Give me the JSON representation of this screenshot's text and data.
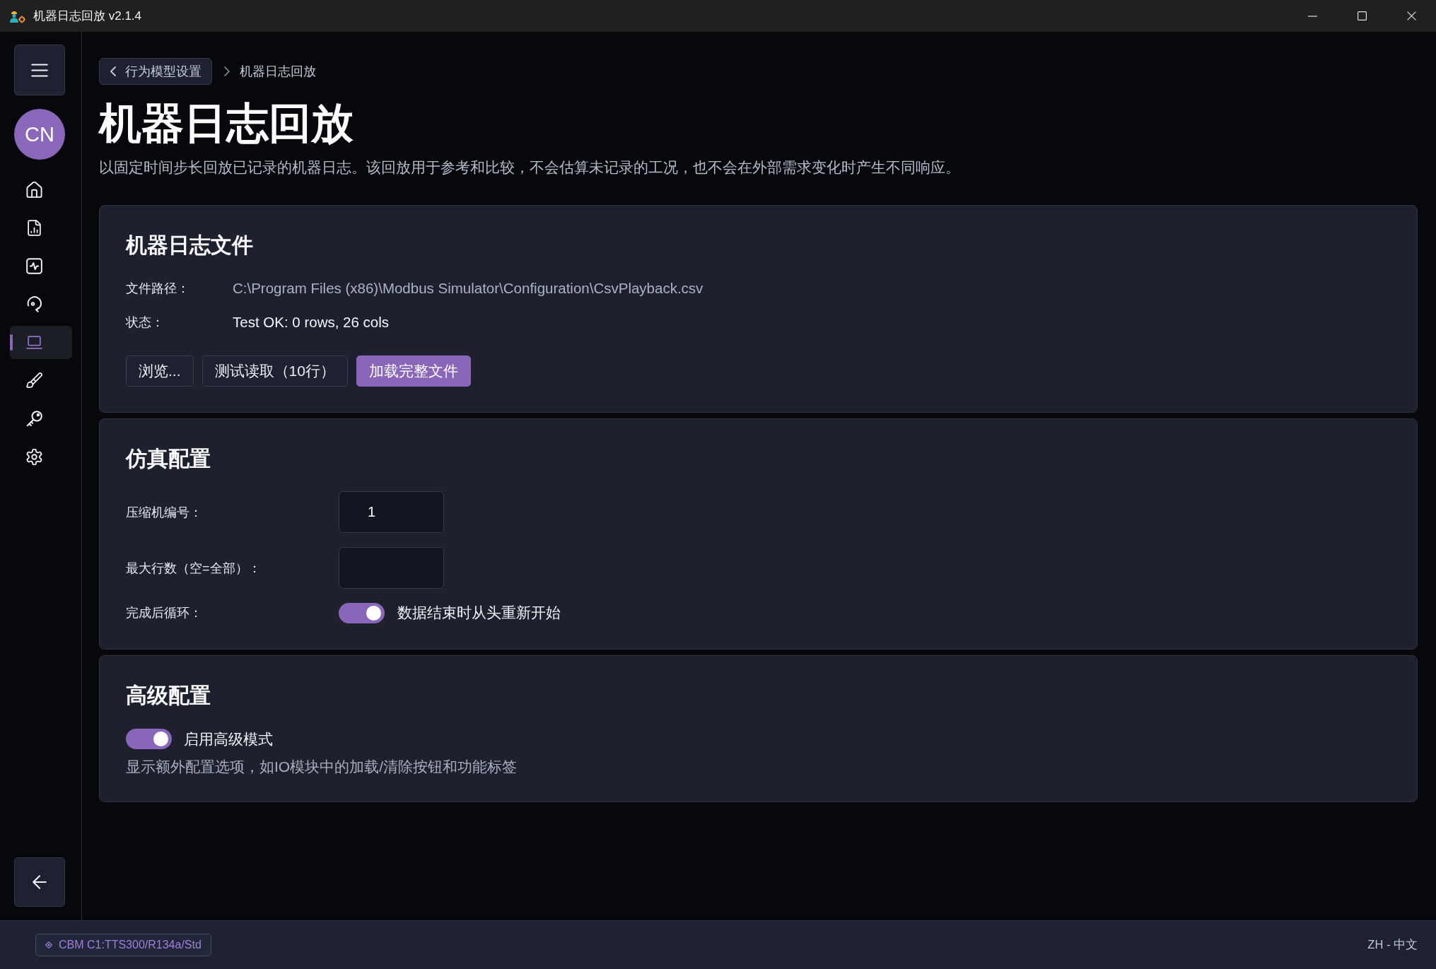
{
  "window": {
    "title": "机器日志回放 v2.1.4"
  },
  "sidebar": {
    "avatar": "CN",
    "items": [
      {
        "kind": "home",
        "selected": false
      },
      {
        "kind": "report",
        "selected": false
      },
      {
        "kind": "activity",
        "selected": false
      },
      {
        "kind": "replay",
        "selected": false
      },
      {
        "kind": "laptop",
        "selected": true
      },
      {
        "kind": "brush",
        "selected": false
      },
      {
        "kind": "key",
        "selected": false
      },
      {
        "kind": "settings",
        "selected": false
      }
    ]
  },
  "breadcrumb": {
    "parent": "行为模型设置",
    "current": "机器日志回放"
  },
  "page": {
    "title": "机器日志回放",
    "description": "以固定时间步长回放已记录的机器日志。该回放用于参考和比较，不会估算未记录的工况，也不会在外部需求变化时产生不同响应。"
  },
  "log_file": {
    "title": "机器日志文件",
    "fields": [
      {
        "kind": "path",
        "label": "文件路径：",
        "value": "C:\\Program Files (x86)\\Modbus Simulator\\Configuration\\CsvPlayback.csv"
      },
      {
        "kind": "status",
        "label": "状态：",
        "value": "Test OK: 0 rows, 26 cols"
      }
    ],
    "buttons": [
      {
        "label": "浏览...",
        "primary": false
      },
      {
        "label": "测试读取（10行）",
        "primary": false
      },
      {
        "label": "加载完整文件",
        "primary": true
      }
    ]
  },
  "simulation": {
    "title": "仿真配置",
    "rows": [
      {
        "kind": "input",
        "label": "压缩机编号：",
        "value": "1"
      },
      {
        "kind": "input",
        "label": "最大行数（空=全部）："
      },
      {
        "kind": "toggle",
        "label": "完成后循环：",
        "on": true,
        "text": "数据结束时从头重新开始"
      }
    ]
  },
  "advanced": {
    "title": "高级配置",
    "toggle": {
      "on": true,
      "label": "启用高级模式"
    },
    "description": "显示额外配置选项，如IO模块中的加载/清除按钮和功能标签"
  },
  "status_bar": {
    "config": "CBM C1:TTS300/R134a/Std",
    "language": "ZH - 中文"
  }
}
